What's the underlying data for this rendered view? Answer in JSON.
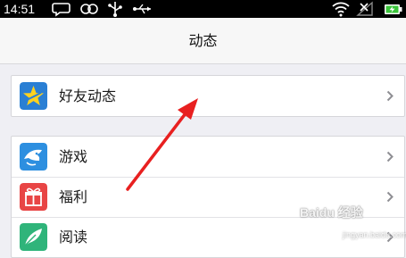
{
  "status_bar": {
    "time": "14:51",
    "left_icons": [
      "speech-bubble-icon",
      "infinity-icon",
      "usb-icon",
      "usb-trident-icon"
    ],
    "right_icons": [
      "wifi-icon",
      "signal-off-icon",
      "battery-charging-icon"
    ]
  },
  "nav": {
    "title": "动态"
  },
  "groups": [
    {
      "items": [
        {
          "label": "好友动态",
          "icon": "qzone-star-icon",
          "color": "#2a7fd4"
        }
      ]
    },
    {
      "items": [
        {
          "label": "游戏",
          "icon": "game-shark-icon",
          "color": "#2d8fe0"
        },
        {
          "label": "福利",
          "icon": "gift-icon",
          "color": "#e84545"
        },
        {
          "label": "阅读",
          "icon": "feather-icon",
          "color": "#2fb47a"
        }
      ]
    }
  ],
  "annotation": {
    "color": "#e82020"
  },
  "watermark": {
    "text": "Baidu 经验",
    "sub": "jingyan.baidu.com"
  }
}
